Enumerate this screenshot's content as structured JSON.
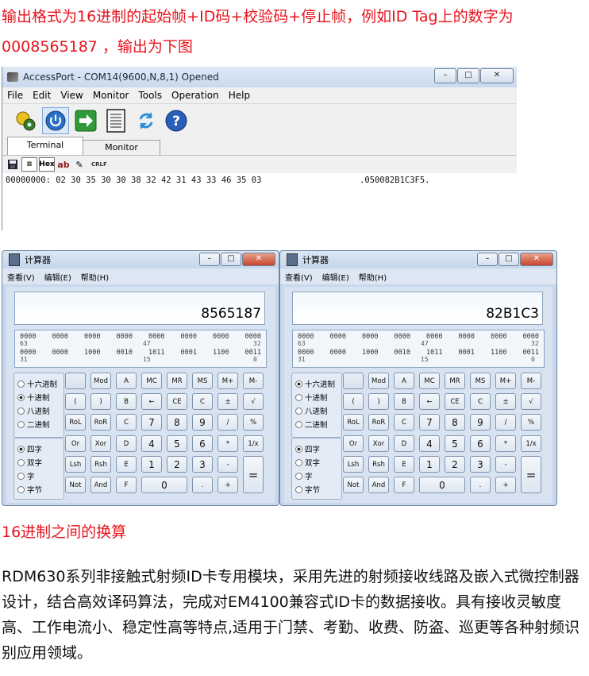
{
  "intro": "输出格式为16进制的起始帧+ID码+校验码+停止帧，例如ID Tag上的数字为 0008565187 ，输出为下图",
  "accessport": {
    "title": "AccessPort - COM14(9600,N,8,1) Opened",
    "menu": [
      "File",
      "Edit",
      "View",
      "Monitor",
      "Tools",
      "Operation",
      "Help"
    ],
    "tabs": [
      "Terminal",
      "Monitor"
    ],
    "sub_hex": "Hex",
    "sub_ab": "ab",
    "sub_crlf": "CRLF",
    "hex_line": "00000000:  02 30 35 30 30 38 32 42 31 43 33 46 35 03",
    "ascii_line": ".050082B1C3F5.",
    "colors": {
      "title_bar": "#c9d9ec",
      "menu_bg": "#f0f0f0"
    }
  },
  "calculators": [
    {
      "title": "计算器",
      "menu": [
        "查看(V)",
        "编辑(E)",
        "帮助(H)"
      ],
      "display": "8565187",
      "bits": {
        "row1": [
          "0000",
          "0000",
          "0000",
          "0000",
          "0000",
          "0000",
          "0000",
          "0000"
        ],
        "idx1": [
          "63",
          "47",
          "32"
        ],
        "row2": [
          "0000",
          "0000",
          "1000",
          "0010",
          "1011",
          "0001",
          "1100",
          "0011"
        ],
        "idx2": [
          "31",
          "15",
          "0"
        ]
      },
      "radix": [
        "十六进制",
        "十进制",
        "八进制",
        "二进制"
      ],
      "radix_selected": 1,
      "word": [
        "四字",
        "双字",
        "字",
        "字节"
      ],
      "word_selected": 0
    },
    {
      "title": "计算器",
      "menu": [
        "查看(V)",
        "编辑(E)",
        "帮助(H)"
      ],
      "display": "82B1C3",
      "bits": {
        "row1": [
          "0000",
          "0000",
          "0000",
          "0000",
          "0000",
          "0000",
          "0000",
          "0000"
        ],
        "idx1": [
          "63",
          "47",
          "32"
        ],
        "row2": [
          "0000",
          "0000",
          "1000",
          "0010",
          "1011",
          "0001",
          "1100",
          "0011"
        ],
        "idx2": [
          "31",
          "15",
          "0"
        ]
      },
      "radix": [
        "十六进制",
        "十进制",
        "八进制",
        "二进制"
      ],
      "radix_selected": 0,
      "word": [
        "四字",
        "双字",
        "字",
        "字节"
      ],
      "word_selected": 0
    }
  ],
  "calc_keys": {
    "r1": [
      "",
      "Mod",
      "A",
      "MC",
      "MR",
      "MS",
      "M+",
      "M-"
    ],
    "r2": [
      "(",
      ")",
      "B",
      "←",
      "CE",
      "C",
      "±",
      "√"
    ],
    "r3": [
      "RoL",
      "RoR",
      "C",
      "7",
      "8",
      "9",
      "/",
      "%"
    ],
    "r4": [
      "Or",
      "Xor",
      "D",
      "4",
      "5",
      "6",
      "*",
      "1/x"
    ],
    "r5": [
      "Lsh",
      "Rsh",
      "E",
      "1",
      "2",
      "3",
      "-"
    ],
    "r6": [
      "Not",
      "And",
      "F",
      "0",
      ".",
      "+"
    ],
    "equals": "="
  },
  "heading2": "16进制之间的换算",
  "paragraph": "  RDM630系列非接触式射频ID卡专用模块，采用先进的射频接收线路及嵌入式微控制器设计，结合高效译码算法，完成对EM4100兼容式ID卡的数据接收。具有接收灵敏度高、工作电流小、稳定性高等特点,适用于门禁、考勤、收费、防盗、巡更等各种射频识别应用领域。",
  "accent_red": "#e8141e"
}
